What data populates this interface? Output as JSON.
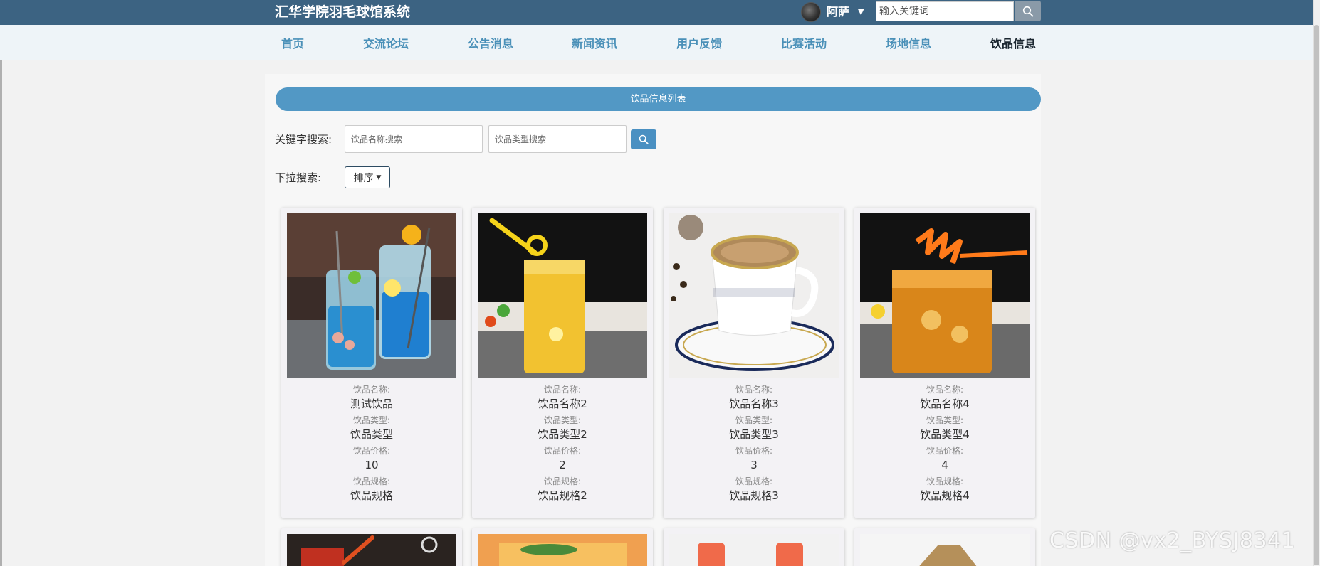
{
  "header": {
    "title": "汇华学院羽毛球馆系统",
    "username": "阿萨",
    "search_placeholder": "输入关键词"
  },
  "nav": [
    {
      "label": "首页",
      "active": false
    },
    {
      "label": "交流论坛",
      "active": false
    },
    {
      "label": "公告消息",
      "active": false
    },
    {
      "label": "新闻资讯",
      "active": false
    },
    {
      "label": "用户反馈",
      "active": false
    },
    {
      "label": "比赛活动",
      "active": false
    },
    {
      "label": "场地信息",
      "active": false
    },
    {
      "label": "饮品信息",
      "active": true
    }
  ],
  "main": {
    "list_title": "饮品信息列表",
    "search_label": "关键字搜索:",
    "name_placeholder": "饮品名称搜索",
    "type_placeholder": "饮品类型搜索",
    "dropdown_label": "下拉搜索:",
    "sort_label": "排序"
  },
  "field_labels": {
    "name": "饮品名称:",
    "type": "饮品类型:",
    "price": "饮品价格:",
    "spec": "饮品规格:"
  },
  "cards": [
    {
      "name": "测试饮品",
      "type": "饮品类型",
      "price": "10",
      "spec": "饮品规格",
      "image": "blue-cocktail-image"
    },
    {
      "name": "饮品名称2",
      "type": "饮品类型2",
      "price": "2",
      "spec": "饮品规格2",
      "image": "yellow-drink-image"
    },
    {
      "name": "饮品名称3",
      "type": "饮品类型3",
      "price": "3",
      "spec": "饮品规格3",
      "image": "coffee-cup-image"
    },
    {
      "name": "饮品名称4",
      "type": "饮品类型4",
      "price": "4",
      "spec": "饮品规格4",
      "image": "orange-tea-image"
    }
  ],
  "watermark": "CSDN @vx2_BYSJ8341",
  "colors": {
    "topbar": "#3c6382",
    "nav_link": "#4a90b8",
    "nav_active": "#1a2630",
    "accent": "#5298c5"
  }
}
